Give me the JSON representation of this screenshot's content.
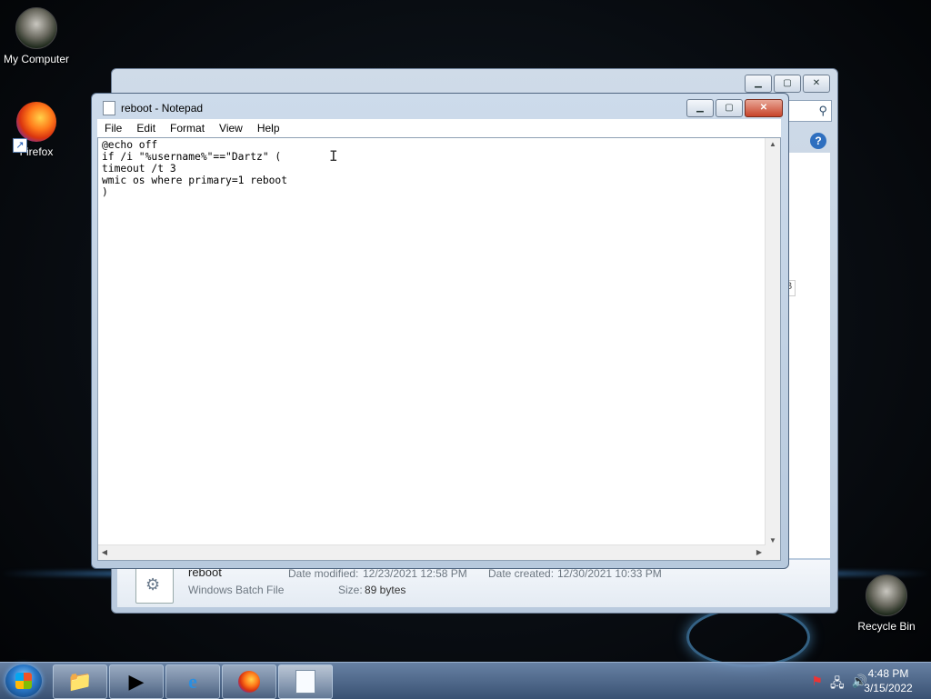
{
  "desktop": {
    "icons": [
      {
        "label": "My Computer"
      },
      {
        "label": "Firefox"
      },
      {
        "label": "Recycle Bin"
      }
    ]
  },
  "explorer": {
    "details": {
      "file_name": "reboot",
      "file_type": "Windows Batch File",
      "date_modified_label": "Date modified:",
      "date_modified": "12/23/2021 12:58 PM",
      "date_created_label": "Date created:",
      "date_created": "12/30/2021 10:33 PM",
      "size_label": "Size:",
      "size": "89 bytes"
    },
    "side_fragment": "B"
  },
  "notepad": {
    "title": "reboot - Notepad",
    "menu": [
      "File",
      "Edit",
      "Format",
      "View",
      "Help"
    ],
    "content": "@echo off\nif /i \"%username%\"==\"Dartz\" (\ntimeout /t 3\nwmic os where primary=1 reboot\n)"
  },
  "taskbar": {
    "apps": [
      "folder-icon",
      "media-player-icon",
      "internet-explorer-icon",
      "firefox-icon",
      "notepad-icon"
    ],
    "clock": {
      "time": "4:48 PM",
      "date": "3/15/2022"
    }
  },
  "colors": {
    "title_bar": "#cddbeb",
    "taskbar": "#4f6f98",
    "close_button": "#c8442a"
  }
}
